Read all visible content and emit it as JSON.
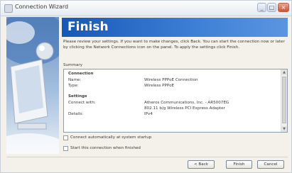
{
  "window": {
    "title": "Connection Wizard",
    "controls": {
      "minimize": "_",
      "maximize": "□",
      "close": "×"
    }
  },
  "header": {
    "title": "Finish"
  },
  "intro_text": "Please review your settings. If you want to make changes, click Back. You can start the connection now or later by clicking the Network Connections icon on the panel. To apply the settings click Finish.",
  "summary": {
    "label": "Summary",
    "sections": {
      "connection": {
        "title": "Connection",
        "name_label": "Name:",
        "name_value": "Wireless PPPoE Connection",
        "type_label": "Type:",
        "type_value": "Wireless PPPoE"
      },
      "settings": {
        "title": "Settings",
        "connect_label": "Connect with:",
        "connect_value_1": "Atheros Communications, Inc. - AR5007EG",
        "connect_value_2": "802.11 b/g Wireless PCI Express Adapter",
        "details_label": "Details:",
        "details_value": "IPv4"
      }
    }
  },
  "options": {
    "connect_auto": {
      "label": "Connect automatically at system startup",
      "checked": false
    },
    "start_now": {
      "label": "Start this connection when finished",
      "checked": false
    }
  },
  "buttons": {
    "back": "< Back",
    "finish": "Finish",
    "cancel": "Cancel"
  },
  "colors": {
    "header_blue": "#1758b7",
    "window_bg": "#f3f1ea"
  },
  "icons": [
    "wizard-icon",
    "network-illustration",
    "scroll-up-arrow",
    "scroll-down-arrow"
  ]
}
